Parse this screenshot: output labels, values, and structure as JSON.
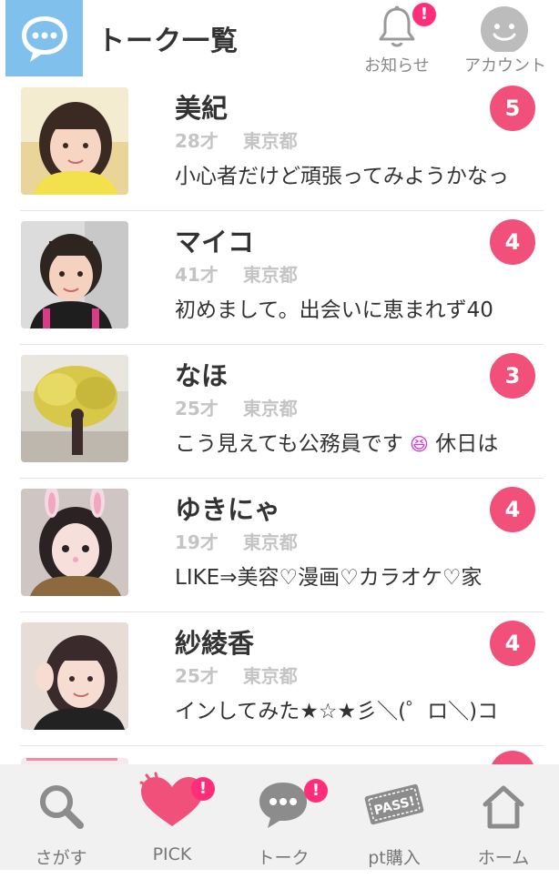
{
  "header": {
    "title": "トーク一覧",
    "notice_label": "お知らせ",
    "notice_badge": "!",
    "account_label": "アカウント"
  },
  "conversations": [
    {
      "name": "美紀",
      "age": "28才",
      "area": "東京都",
      "message": "小心者だけど頑張ってみようかなっ",
      "unread": "5"
    },
    {
      "name": "マイコ",
      "age": "41才",
      "area": "東京都",
      "message": "初めまして。出会いに恵まれず40",
      "unread": "4"
    },
    {
      "name": "なほ",
      "age": "25才",
      "area": "東京都",
      "message": "こう見えても公務員です",
      "message_emoji": "😆",
      "message_tail": "休日は",
      "unread": "3"
    },
    {
      "name": "ゆきにゃ",
      "age": "19才",
      "area": "東京都",
      "message": "LIKE⇒美容♡漫画♡カラオケ♡家",
      "unread": "4"
    },
    {
      "name": "紗綾香",
      "age": "25才",
      "area": "東京都",
      "message": "インしてみた★☆★彡＼(゜ロ＼)コ",
      "unread": "4"
    }
  ],
  "tabbar": {
    "items": [
      {
        "label": "さがす",
        "icon": "search-icon"
      },
      {
        "label": "PICK",
        "icon": "heart-icon",
        "badge": "!"
      },
      {
        "label": "トーク",
        "icon": "chat-icon",
        "badge": "!"
      },
      {
        "label": "pt購入",
        "icon": "pass-ticket-icon"
      },
      {
        "label": "ホーム",
        "icon": "home-icon"
      }
    ]
  },
  "colors": {
    "accent_badge": "#f0507a",
    "alert_badge": "#ff2d7a",
    "logo_bg": "#7fc0ec",
    "tabbar_bg": "#f1f1f1"
  }
}
